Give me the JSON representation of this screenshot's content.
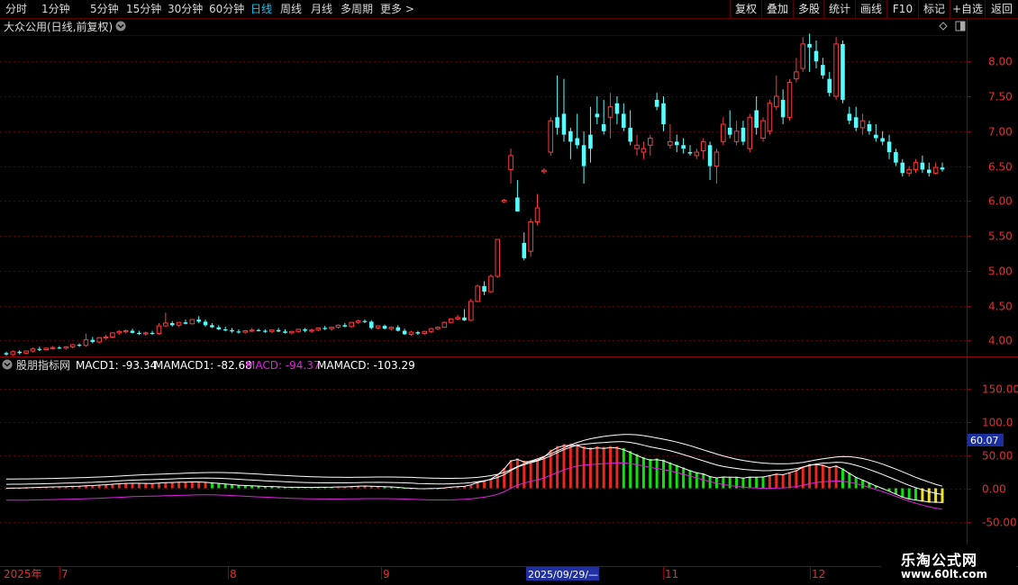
{
  "toolbar": {
    "tabs": [
      "分时",
      "1分钟",
      "5分钟",
      "15分钟",
      "30分钟",
      "60分钟",
      "日线",
      "周线",
      "月线",
      "多周期",
      "更多"
    ],
    "active_tab": "日线",
    "right_buttons": [
      "复权",
      "叠加",
      "多股",
      "统计",
      "画线",
      "F10",
      "标记",
      "+自选",
      "返回"
    ]
  },
  "main_panel": {
    "title": "大众公用(日线,前复权)",
    "price_ticks": [
      "8.00",
      "7.50",
      "7.00",
      "6.50",
      "6.00",
      "5.50",
      "5.00",
      "4.50",
      "4.00"
    ]
  },
  "indicator_panel": {
    "name": "股朋指标网",
    "macd1_label": "MACD1: -93.34",
    "mamacd1_label": "MAMACD1: -82.68",
    "macd_label": "MACD: -94.37",
    "mamacd_label": "MAMACD: -103.29",
    "ticks": [
      "150.00",
      "100.0",
      "50.00",
      "0.00",
      "-50.00"
    ],
    "crosshair_value": "60.07",
    "colors": {
      "up": "#e8281e",
      "down": "#10e010",
      "yellow": "#f0e020",
      "macd1": "#ffffff",
      "macd": "#e020e0"
    }
  },
  "time_axis": {
    "labels": [
      "2025年",
      "7",
      "8",
      "9",
      "2025/09/29/—",
      "11",
      "12"
    ],
    "highlight": "2025/09/29/—"
  },
  "watermark": {
    "name": "乐淘公式网",
    "url": "www.60lt.com"
  },
  "colors": {
    "up": "#ff3b3b",
    "down": "#54ffff",
    "border": "#8b0000",
    "grid": "#5a0000",
    "tick": "#e03030",
    "bg": "#000000"
  },
  "chart_data": {
    "type": "candlestick",
    "ylim": [
      3.7,
      8.35
    ],
    "candles": [
      [
        3.82,
        3.84,
        3.78,
        3.8
      ],
      [
        3.8,
        3.86,
        3.78,
        3.84
      ],
      [
        3.84,
        3.86,
        3.8,
        3.82
      ],
      [
        3.82,
        3.86,
        3.8,
        3.85
      ],
      [
        3.85,
        3.9,
        3.83,
        3.88
      ],
      [
        3.88,
        3.91,
        3.85,
        3.87
      ],
      [
        3.87,
        3.9,
        3.86,
        3.89
      ],
      [
        3.89,
        3.92,
        3.87,
        3.9
      ],
      [
        3.9,
        3.92,
        3.88,
        3.89
      ],
      [
        3.89,
        3.92,
        3.87,
        3.91
      ],
      [
        3.91,
        3.95,
        3.89,
        3.94
      ],
      [
        3.94,
        3.96,
        3.91,
        3.93
      ],
      [
        3.93,
        4.1,
        3.91,
        4.01
      ],
      [
        4.01,
        4.05,
        3.96,
        3.98
      ],
      [
        3.98,
        4.05,
        3.96,
        4.04
      ],
      [
        4.04,
        4.08,
        4.01,
        4.05
      ],
      [
        4.05,
        4.12,
        4.03,
        4.11
      ],
      [
        4.11,
        4.15,
        4.08,
        4.13
      ],
      [
        4.13,
        4.16,
        4.1,
        4.14
      ],
      [
        4.14,
        4.17,
        4.1,
        4.11
      ],
      [
        4.11,
        4.14,
        4.08,
        4.1
      ],
      [
        4.1,
        4.13,
        4.07,
        4.11
      ],
      [
        4.11,
        4.14,
        4.08,
        4.1
      ],
      [
        4.1,
        4.25,
        4.08,
        4.21
      ],
      [
        4.21,
        4.4,
        4.2,
        4.25
      ],
      [
        4.25,
        4.28,
        4.2,
        4.22
      ],
      [
        4.22,
        4.27,
        4.2,
        4.26
      ],
      [
        4.26,
        4.3,
        4.23,
        4.24
      ],
      [
        4.24,
        4.31,
        4.23,
        4.3
      ],
      [
        4.3,
        4.35,
        4.25,
        4.27
      ],
      [
        4.27,
        4.3,
        4.2,
        4.22
      ],
      [
        4.22,
        4.25,
        4.18,
        4.19
      ],
      [
        4.19,
        4.22,
        4.15,
        4.16
      ],
      [
        4.16,
        4.2,
        4.13,
        4.15
      ],
      [
        4.15,
        4.18,
        4.11,
        4.13
      ],
      [
        4.13,
        4.16,
        4.1,
        4.12
      ],
      [
        4.12,
        4.15,
        4.1,
        4.14
      ],
      [
        4.14,
        4.18,
        4.12,
        4.15
      ],
      [
        4.15,
        4.17,
        4.13,
        4.14
      ],
      [
        4.14,
        4.16,
        4.11,
        4.13
      ],
      [
        4.13,
        4.16,
        4.11,
        4.15
      ],
      [
        4.15,
        4.18,
        4.12,
        4.13
      ],
      [
        4.13,
        4.16,
        4.1,
        4.11
      ],
      [
        4.11,
        4.14,
        4.09,
        4.13
      ],
      [
        4.13,
        4.17,
        4.11,
        4.16
      ],
      [
        4.16,
        4.18,
        4.12,
        4.14
      ],
      [
        4.14,
        4.17,
        4.11,
        4.15
      ],
      [
        4.15,
        4.19,
        4.13,
        4.18
      ],
      [
        4.18,
        4.21,
        4.15,
        4.17
      ],
      [
        4.17,
        4.2,
        4.14,
        4.19
      ],
      [
        4.19,
        4.23,
        4.17,
        4.22
      ],
      [
        4.22,
        4.25,
        4.19,
        4.2
      ],
      [
        4.2,
        4.27,
        4.18,
        4.26
      ],
      [
        4.26,
        4.3,
        4.24,
        4.28
      ],
      [
        4.28,
        4.3,
        4.25,
        4.27
      ],
      [
        4.27,
        4.29,
        4.16,
        4.18
      ],
      [
        4.18,
        4.22,
        4.16,
        4.21
      ],
      [
        4.21,
        4.23,
        4.16,
        4.17
      ],
      [
        4.17,
        4.2,
        4.14,
        4.19
      ],
      [
        4.19,
        4.22,
        4.13,
        4.14
      ],
      [
        4.14,
        4.17,
        4.08,
        4.09
      ],
      [
        4.09,
        4.14,
        4.07,
        4.12
      ],
      [
        4.12,
        4.14,
        4.08,
        4.1
      ],
      [
        4.1,
        4.14,
        4.08,
        4.13
      ],
      [
        4.13,
        4.18,
        4.11,
        4.17
      ],
      [
        4.17,
        4.2,
        4.15,
        4.19
      ],
      [
        4.19,
        4.27,
        4.18,
        4.26
      ],
      [
        4.26,
        4.32,
        4.25,
        4.31
      ],
      [
        4.31,
        4.37,
        4.29,
        4.33
      ],
      [
        4.33,
        4.45,
        4.28,
        4.29
      ],
      [
        4.29,
        4.6,
        4.28,
        4.56
      ],
      [
        4.56,
        4.8,
        4.55,
        4.78
      ],
      [
        4.78,
        4.85,
        4.65,
        4.7
      ],
      [
        4.7,
        4.95,
        4.68,
        4.92
      ],
      [
        4.92,
        5.45,
        4.9,
        5.45
      ],
      [
        5.99,
        6.03,
        5.97,
        6.01
      ],
      [
        6.45,
        6.75,
        6.25,
        6.65
      ],
      [
        6.05,
        6.3,
        5.85,
        5.85
      ],
      [
        5.4,
        5.55,
        5.15,
        5.18
      ],
      [
        5.28,
        5.75,
        5.2,
        5.7
      ],
      [
        5.7,
        6.1,
        5.65,
        5.9
      ],
      [
        6.42,
        6.47,
        6.39,
        6.44
      ],
      [
        6.7,
        7.2,
        6.65,
        7.15
      ],
      [
        7.2,
        7.8,
        6.95,
        7.05
      ],
      [
        7.25,
        7.75,
        6.85,
        6.95
      ],
      [
        7.0,
        7.05,
        6.6,
        6.85
      ],
      [
        6.9,
        7.25,
        6.75,
        6.8
      ],
      [
        6.8,
        7.0,
        6.25,
        6.5
      ],
      [
        6.95,
        7.35,
        6.55,
        6.75
      ],
      [
        7.25,
        7.5,
        7.1,
        7.2
      ],
      [
        7.1,
        7.45,
        6.95,
        7.0
      ],
      [
        7.2,
        7.55,
        6.9,
        7.35
      ],
      [
        7.4,
        7.5,
        7.1,
        7.25
      ],
      [
        7.25,
        7.4,
        7.0,
        7.05
      ],
      [
        7.05,
        7.3,
        6.8,
        6.85
      ],
      [
        6.75,
        6.95,
        6.65,
        6.8
      ],
      [
        6.7,
        6.85,
        6.6,
        6.75
      ],
      [
        6.8,
        6.95,
        6.65,
        6.9
      ],
      [
        7.45,
        7.55,
        7.3,
        7.35
      ],
      [
        7.4,
        7.5,
        7.0,
        7.1
      ],
      [
        6.8,
        7.1,
        6.75,
        6.85
      ],
      [
        6.85,
        6.95,
        6.7,
        6.8
      ],
      [
        6.8,
        6.9,
        6.68,
        6.75
      ],
      [
        6.7,
        6.8,
        6.65,
        6.68
      ],
      [
        6.65,
        6.75,
        6.6,
        6.7
      ],
      [
        6.72,
        6.9,
        6.6,
        6.85
      ],
      [
        6.8,
        6.85,
        6.3,
        6.5
      ],
      [
        6.5,
        6.75,
        6.25,
        6.7
      ],
      [
        6.85,
        7.2,
        6.8,
        7.1
      ],
      [
        7.05,
        7.3,
        6.9,
        6.95
      ],
      [
        6.85,
        7.15,
        6.8,
        7.0
      ],
      [
        7.05,
        7.15,
        6.8,
        6.85
      ],
      [
        6.75,
        7.25,
        6.7,
        7.2
      ],
      [
        7.3,
        7.5,
        6.95,
        7.05
      ],
      [
        6.9,
        7.2,
        6.85,
        7.15
      ],
      [
        7.0,
        7.45,
        6.95,
        7.4
      ],
      [
        7.35,
        7.8,
        7.3,
        7.5
      ],
      [
        7.45,
        7.6,
        7.1,
        7.2
      ],
      [
        7.2,
        7.75,
        7.15,
        7.7
      ],
      [
        7.75,
        8.05,
        7.7,
        7.85
      ],
      [
        7.9,
        8.35,
        7.85,
        8.25
      ],
      [
        8.25,
        8.4,
        7.85,
        8.2
      ],
      [
        8.15,
        8.3,
        7.9,
        8.0
      ],
      [
        7.95,
        8.05,
        7.75,
        7.8
      ],
      [
        7.75,
        7.85,
        7.5,
        7.55
      ],
      [
        7.5,
        8.35,
        7.45,
        8.25
      ],
      [
        8.25,
        8.3,
        7.4,
        7.45
      ],
      [
        7.25,
        7.35,
        7.1,
        7.15
      ],
      [
        7.2,
        7.35,
        7.0,
        7.05
      ],
      [
        7.05,
        7.25,
        6.95,
        7.15
      ],
      [
        7.1,
        7.15,
        6.95,
        7.0
      ],
      [
        6.95,
        7.1,
        6.85,
        6.9
      ],
      [
        6.9,
        7.0,
        6.8,
        6.85
      ],
      [
        6.85,
        6.95,
        6.6,
        6.7
      ],
      [
        6.7,
        6.75,
        6.5,
        6.55
      ],
      [
        6.55,
        6.6,
        6.35,
        6.4
      ],
      [
        6.4,
        6.5,
        6.35,
        6.45
      ],
      [
        6.45,
        6.6,
        6.4,
        6.55
      ],
      [
        6.55,
        6.65,
        6.4,
        6.45
      ],
      [
        6.45,
        6.55,
        6.35,
        6.4
      ],
      [
        6.4,
        6.55,
        6.38,
        6.48
      ],
      [
        6.48,
        6.55,
        6.42,
        6.45
      ]
    ]
  }
}
